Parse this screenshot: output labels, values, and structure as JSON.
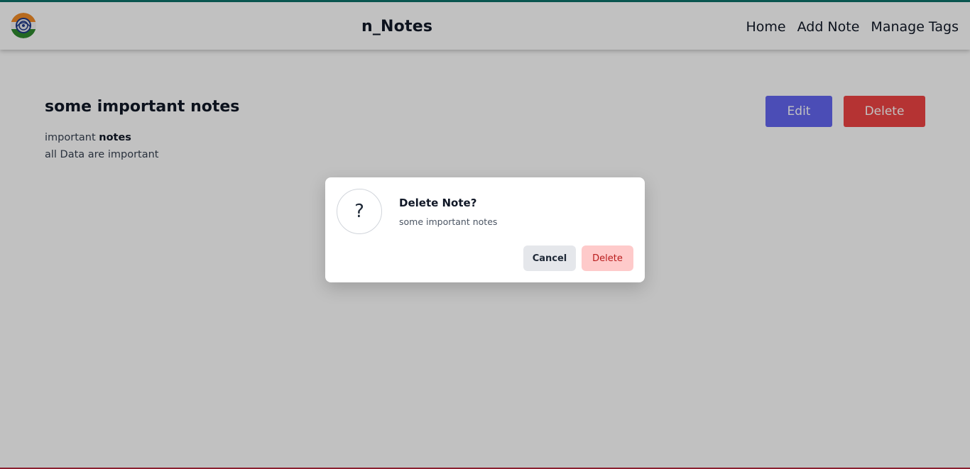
{
  "navbar": {
    "brand": "n_Notes",
    "links": [
      {
        "label": "Home"
      },
      {
        "label": "Add Note"
      },
      {
        "label": "Manage Tags"
      }
    ]
  },
  "note": {
    "title": "some important notes",
    "body_prefix": "important",
    "body_bold": "notes",
    "body_line2": "all Data are important",
    "edit_label": "Edit",
    "delete_label": "Delete"
  },
  "dialog": {
    "icon_glyph": "?",
    "title": "Delete Note?",
    "message": "some important notes",
    "cancel_label": "Cancel",
    "confirm_label": "Delete"
  },
  "colors": {
    "accent_top": "#0f766e",
    "edit_button": "#6366f1",
    "delete_button": "#ef4444",
    "confirm_bg": "#fecaca",
    "confirm_text": "#b91c1c",
    "overlay": "rgba(0,0,0,0.245)"
  }
}
